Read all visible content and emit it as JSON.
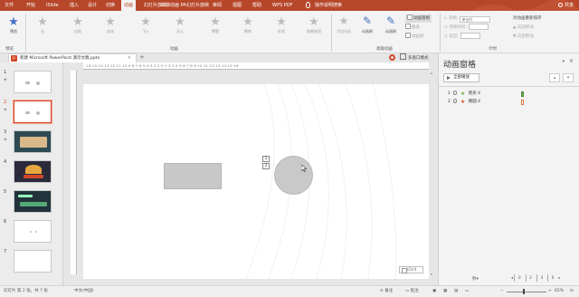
{
  "ribbon_tabs": [
    "文件",
    "开始",
    "iSlide",
    "插入",
    "设计",
    "切换",
    "动画",
    "幻灯片放映",
    "口袋动画 PA",
    "幻灯片放映",
    "审阅",
    "视图",
    "帮助",
    "WPS PDF"
  ],
  "active_tab": "动画",
  "tell_me": "操作说明搜索",
  "share_label": "共享",
  "ribbon": {
    "preview_label": "预览",
    "preview_group": "预览",
    "effects": [
      "无",
      "出现",
      "淡化",
      "飞入",
      "浮入",
      "劈裂",
      "擦除",
      "形状"
    ],
    "effect_options": "效果选项",
    "animation_group": "动画",
    "add_animation": "添加动画",
    "animation_painter": "动画刷",
    "advanced_group": "高级动画",
    "animation_pane_btn": "动画窗格",
    "trigger": "触发",
    "start_label": "开始:",
    "start_value": "单击时",
    "duration_label": "持续时间:",
    "delay_label": "延迟:",
    "reorder_label": "对动画重新排序",
    "move_earlier": "向前移动",
    "move_later": "向后移动",
    "timing_group": "计时"
  },
  "document": {
    "tab_title": "新建 Microsoft PowerPoint 演示文稿.pptx",
    "icon_letter": "P",
    "close_glyph": "×",
    "add_glyph": "+",
    "window_mode": "多窗口模式"
  },
  "thumbnails": [
    {
      "num": "1",
      "star": "★"
    },
    {
      "num": "2",
      "star": "★"
    },
    {
      "num": "3",
      "star": "★"
    },
    {
      "num": "4",
      "star": ""
    },
    {
      "num": "5",
      "star": ""
    },
    {
      "num": "6",
      "star": ""
    },
    {
      "num": "7",
      "star": ""
    }
  ],
  "ruler_text": "·16·15·14·13·12·11·10·9·8·7·6·5·4·3·2·1·0·1·2·3·4·5·6·7·8·9·10·11·12·13·14·15·16·",
  "canvas": {
    "tag_1": "1",
    "tag_2": "2",
    "paste_ctrl": "(Ctrl)"
  },
  "animation_pane": {
    "title": "动画窗格",
    "play_all": "全部播放",
    "close_glyph": "×",
    "options_glyph": "▾",
    "up_glyph": "▴",
    "down_glyph": "▾",
    "items": [
      {
        "num": "1",
        "name": "矩形 4",
        "star_color": "#70ad47"
      },
      {
        "num": "2",
        "name": "椭圆 4",
        "star_color": "#e05a2b"
      }
    ],
    "seconds_label": "秒▾",
    "timeline": [
      "0",
      "2",
      "4",
      "6"
    ]
  },
  "status_bar": {
    "slide_info": "幻灯片 第 2 张，共 7 张",
    "language": "中文(中国)",
    "notes": "备注",
    "comments": "批注",
    "zoom": "65%",
    "zoom_minus": "−",
    "zoom_plus": "+"
  },
  "colors": {
    "accent": "#b7472a",
    "ribbon_bg": "#f3f3f3",
    "pane_title": "#333333"
  }
}
